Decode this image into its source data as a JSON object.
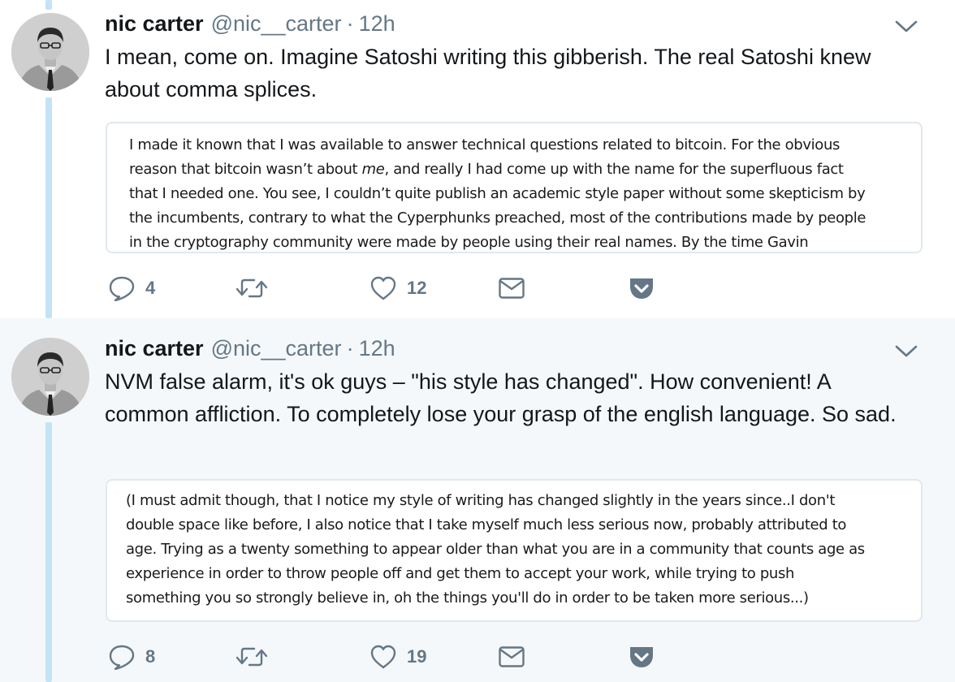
{
  "tweets": [
    {
      "author_name": "nic carter",
      "handle": "@nic__carter",
      "separator": "·",
      "time": "12h",
      "text": "I mean, come on. Imagine Satoshi writing this gibberish. The real Satoshi knew about comma splices.",
      "quote_lines": [
        "I made it known that I was available to answer technical questions related to bitcoin. For the obvious",
        "reason that bitcoin wasn’t about |me|, and really I had come up with the name for the superfluous fact",
        "that I needed one. You see, I couldn’t quite publish an academic style paper without some skepticism by",
        "the incumbents, contrary to what the Cyperphunks preached, most of the contributions made by people",
        "in the cryptography community were made by people using their real names. By the time Gavin"
      ],
      "reply_count": "4",
      "retweet_count": "",
      "like_count": "12"
    },
    {
      "author_name": "nic carter",
      "handle": "@nic__carter",
      "separator": "·",
      "time": "12h",
      "text": "NVM false alarm, it's ok guys – \"his style has changed\". How convenient! A common affliction. To completely lose your grasp of the english language. So sad.",
      "quote_lines": [
        "(I must admit though, that I notice my style of writing has changed slightly in the years since..I don't",
        "double space like before, I also notice that I take myself much less serious now, probably attributed to",
        "age. Trying as a twenty something to appear older than what you are in a community that counts age as",
        "experience in order to throw people off and get them to accept your work, while trying to push",
        "something you so strongly believe in, oh the things you'll do in order to be taken more serious...)"
      ],
      "reply_count": "8",
      "retweet_count": "",
      "like_count": "19"
    }
  ],
  "icons": {
    "reply": "speech-bubble",
    "retweet": "retweet-arrows",
    "like": "heart-outline",
    "dm": "envelope",
    "pocket": "pocket-save",
    "menu": "chevron-down"
  },
  "colors": {
    "text": "#14171a",
    "secondary": "#657786",
    "thread_line": "#c4e3f7",
    "alt_background": "#f5f8fa",
    "pocket": "#657786"
  }
}
